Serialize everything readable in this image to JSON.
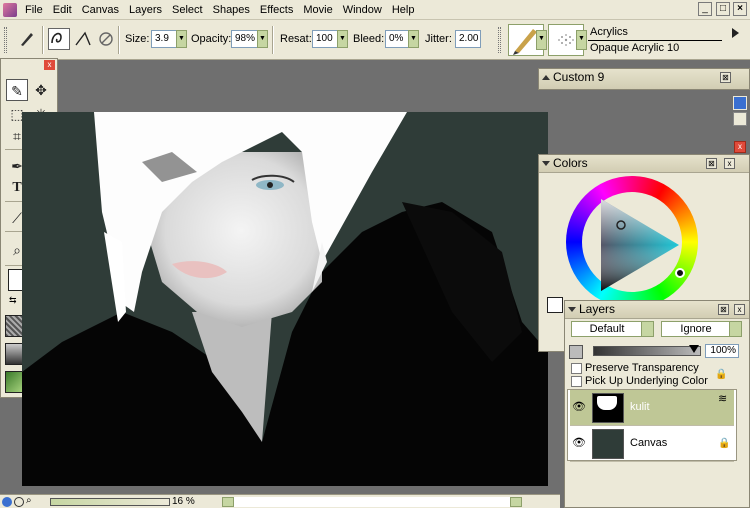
{
  "menu": {
    "items": [
      "File",
      "Edit",
      "Canvas",
      "Layers",
      "Select",
      "Shapes",
      "Effects",
      "Movie",
      "Window",
      "Help"
    ]
  },
  "window_controls": {
    "minimize": "_",
    "restore": "□",
    "close": "×"
  },
  "property_bar": {
    "size_label": "Size:",
    "size_value": "3.9",
    "opacity_label": "Opacity:",
    "opacity_value": "98%",
    "resat_label": "Resat:",
    "resat_value": "100",
    "bleed_label": "Bleed:",
    "bleed_value": "0%",
    "jitter_label": "Jitter:",
    "jitter_value": "2.00",
    "brush_category": "Acrylics",
    "brush_variant": "Opaque Acrylic 10"
  },
  "status_bar": {
    "zoom": "16 %"
  },
  "custom_palette": {
    "title": "Custom  9"
  },
  "colors_palette": {
    "title": "Colors"
  },
  "layers_palette": {
    "title": "Layers",
    "composite_method": "Default",
    "composite_depth": "Ignore",
    "opacity": "100%",
    "preserve_transparency": "Preserve Transparency",
    "pick_up_underlying": "Pick Up Underlying Color",
    "layers": [
      {
        "name": "kulit"
      },
      {
        "name": "Canvas"
      }
    ]
  },
  "colors": {
    "accent": "#c6d6a2",
    "canvas_bg": "#2f3c38",
    "secondary_swatch": "#a8dde0",
    "selected_layer": "#bfc796"
  }
}
